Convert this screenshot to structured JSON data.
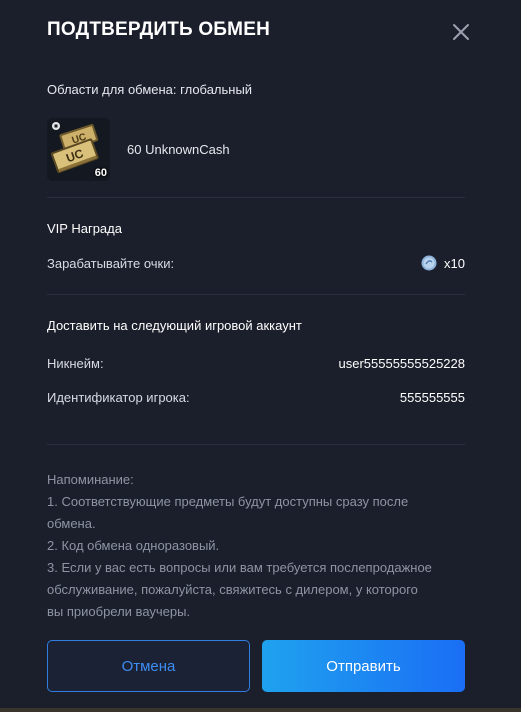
{
  "dialog": {
    "title": "ПОДТВЕРДИТЬ ОБМЕН",
    "close_icon": "close-icon"
  },
  "region": {
    "text": "Области для обмена: глобальный"
  },
  "item": {
    "icon": "unknowncash-stack-icon",
    "quantity_badge": "60",
    "name": "60 UnknownCash"
  },
  "vip": {
    "title": "VIP Награда",
    "earn_label": "Зарабатывайте очки:",
    "points_icon": "vip-coin-icon",
    "points_value": "x10"
  },
  "account": {
    "title": "Доставить на следующий игровой аккаунт",
    "nickname_label": "Никнейм:",
    "nickname_value": "user55555555525228",
    "player_id_label": "Идентификатор игрока:",
    "player_id_value": "555555555"
  },
  "reminder": {
    "heading": "Напоминание:",
    "lines": [
      "1. Соответствующие предметы будут доступны сразу после",
      "обмена.",
      "2. Код обмена одноразовый.",
      "3. Если у вас есть вопросы или вам требуется послепродажное",
      "обслуживание, пожалуйста, свяжитесь с дилером, у которого",
      "вы приобрели ваучеры."
    ]
  },
  "buttons": {
    "cancel_label": "Отмена",
    "submit_label": "Отправить"
  },
  "colors": {
    "background": "#1b1f2b",
    "accent_blue": "#1a6ef5",
    "cancel_border": "#2f7de0"
  }
}
